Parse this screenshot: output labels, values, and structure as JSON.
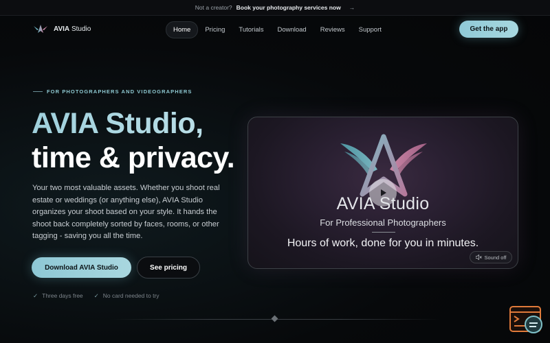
{
  "announcement": {
    "prefix": "Not a creator?",
    "link": "Book your photography services now",
    "arrow": "→"
  },
  "nav": {
    "logo_icon": "avia-wings-logo-icon",
    "logo_brand": "AVIA",
    "logo_suffix": "Studio",
    "items": [
      {
        "label": "Home",
        "active": true
      },
      {
        "label": "Pricing"
      },
      {
        "label": "Tutorials"
      },
      {
        "label": "Download"
      },
      {
        "label": "Reviews"
      },
      {
        "label": "Support"
      }
    ],
    "cta": "Get the app"
  },
  "hero": {
    "eyebrow": "FOR PHOTOGRAPHERS AND VIDEOGRAPHERS",
    "title_line1": "AVIA Studio,",
    "title_line2": "time & privacy.",
    "description": "Your two most valuable assets. Whether you shoot real estate or weddings (or anything else), AVIA Studio organizes your shoot based on your style. It hands the shoot back completely sorted by faces, rooms, or other tagging - saving you all the time.",
    "primary_button": "Download AVIA Studio",
    "secondary_button": "See pricing",
    "checks": [
      "Three days free",
      "No card needed to try"
    ]
  },
  "video": {
    "brand": "AVIA Studio",
    "subtitle": "For Professional Photographers",
    "tagline": "Hours of work, done for you in minutes.",
    "sound_label": "Sound off",
    "play_icon": "play-icon",
    "mute_icon": "speaker-mute-icon"
  },
  "colors": {
    "accent": "#9fd0dc",
    "background": "#07090b",
    "widget": "#e07a3a"
  }
}
